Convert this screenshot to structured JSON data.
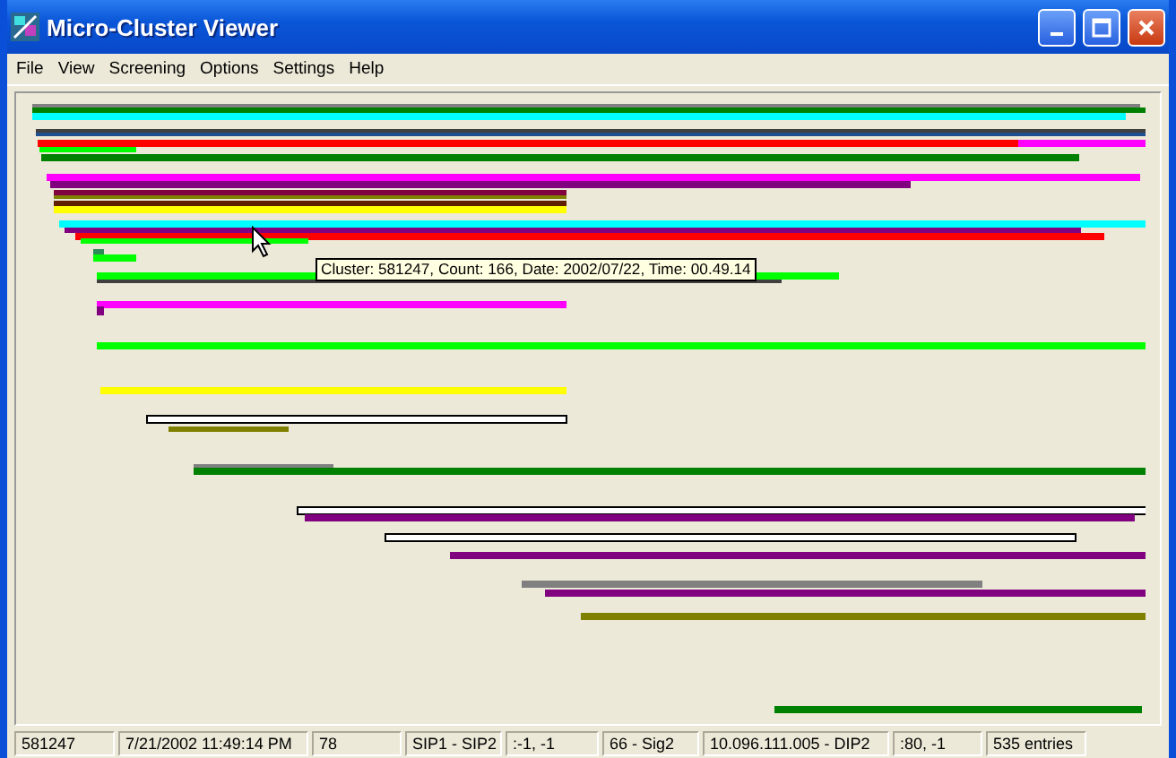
{
  "window": {
    "title": "Micro-Cluster Viewer"
  },
  "menu": [
    "File",
    "View",
    "Screening",
    "Options",
    "Settings",
    "Help"
  ],
  "tooltip": "Cluster: 581247, Count: 166, Date: 2002/07/22, Time: 00.49.14",
  "status_bar": [
    "581247",
    "7/21/2002 11:49:14 PM",
    "78",
    "SIP1 - SIP2",
    ":-1, -1",
    "66 - Sig2",
    "10.096.111.005 - DIP2",
    ":80, -1",
    "535 entries"
  ]
}
